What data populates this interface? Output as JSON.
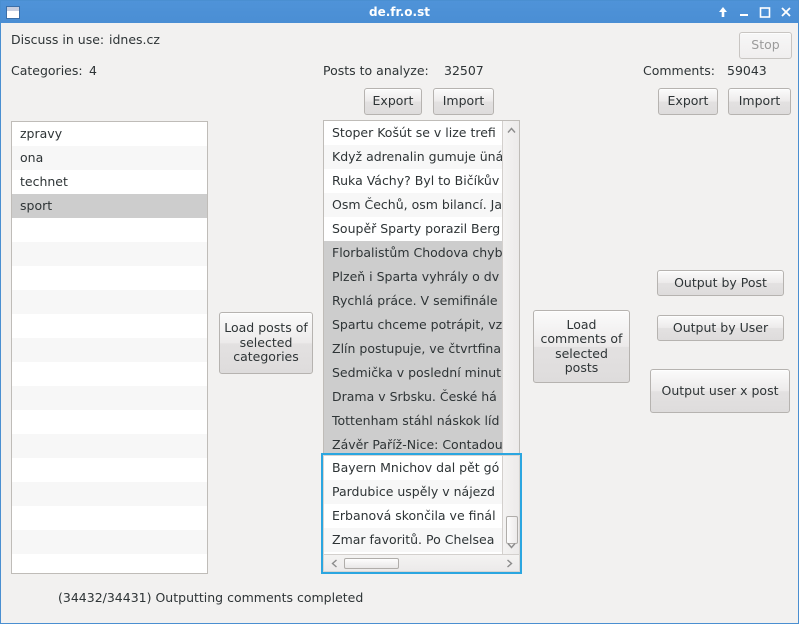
{
  "window": {
    "title": "de.fr.o.st",
    "icon": "window-icon",
    "buttons": [
      {
        "name": "shade-button",
        "icon": "up-arrow-icon",
        "label": "↑"
      },
      {
        "name": "minimize-button",
        "icon": "minimize-icon",
        "label": "_"
      },
      {
        "name": "maximize-button",
        "icon": "maximize-icon",
        "label": "□"
      },
      {
        "name": "close-button",
        "icon": "close-icon",
        "label": "X"
      }
    ]
  },
  "header": {
    "discuss_label": "Discuss in use:",
    "discuss_value": "idnes.cz",
    "stop_label": "Stop",
    "stop_enabled": false,
    "categories_label": "Categories:",
    "categories_value": "4",
    "posts_label": "Posts to analyze:",
    "posts_value": "32507",
    "comments_label": "Comments:",
    "comments_value": "59043",
    "posts_export_label": "Export",
    "posts_import_label": "Import",
    "comments_export_label": "Export",
    "comments_import_label": "Import"
  },
  "categories": {
    "items": [
      {
        "label": "zpravy",
        "selected": false
      },
      {
        "label": "ona",
        "selected": false
      },
      {
        "label": "technet",
        "selected": false
      },
      {
        "label": "sport",
        "selected": true
      },
      {
        "label": "",
        "selected": false
      },
      {
        "label": "",
        "selected": false
      },
      {
        "label": "",
        "selected": false
      },
      {
        "label": "",
        "selected": false
      },
      {
        "label": "",
        "selected": false
      },
      {
        "label": "",
        "selected": false
      },
      {
        "label": "",
        "selected": false
      },
      {
        "label": "",
        "selected": false
      },
      {
        "label": "",
        "selected": false
      },
      {
        "label": "",
        "selected": false
      },
      {
        "label": "",
        "selected": false
      },
      {
        "label": "",
        "selected": false
      },
      {
        "label": "",
        "selected": false
      },
      {
        "label": "",
        "selected": false
      }
    ]
  },
  "load_posts_button": "Load posts of selected categories",
  "load_comments_button": "Load comments of selected posts",
  "posts": {
    "items": [
      {
        "label": "Stoper Košút se v lize trefi",
        "selected": false
      },
      {
        "label": "Když adrenalin gumuje üná",
        "selected": false
      },
      {
        "label": "Ruka Váchy? Byl to Bičíkův",
        "selected": false
      },
      {
        "label": "Osm Čechů, osm bilancí. Ja",
        "selected": false
      },
      {
        "label": "Soupěř Sparty porazil Berg",
        "selected": false
      },
      {
        "label": "Florbalistům Chodova chyb",
        "selected": true
      },
      {
        "label": "Plzeň i Sparta vyhrály o dv",
        "selected": true
      },
      {
        "label": "Rychlá práce. V semifinále",
        "selected": true
      },
      {
        "label": "Spartu chceme potrápit, vz",
        "selected": true
      },
      {
        "label": "Zlín postupuje, ve čtvrtfina",
        "selected": true
      },
      {
        "label": "Sedmička v poslední minut",
        "selected": true
      },
      {
        "label": "Drama v Srbsku. České há",
        "selected": true
      },
      {
        "label": "Tottenham stáhl náskok líd",
        "selected": true
      },
      {
        "label": "Závěr Paříž-Nice: Contadou",
        "selected": true
      }
    ],
    "overlay_items": [
      {
        "label": "Bayern Mnichov dal pět gó",
        "selected": false
      },
      {
        "label": "Pardubice uspěly v nájezd",
        "selected": false
      },
      {
        "label": "Erbanová skončila ve finál",
        "selected": false
      },
      {
        "label": "Zmar favoritů. Po Chelsea ",
        "selected": false
      }
    ],
    "vscroll_up_icon": "chevron-up-icon",
    "vscroll_down_icon": "chevron-down-icon",
    "hscroll_left_icon": "chevron-left-icon",
    "hscroll_right_icon": "chevron-right-icon"
  },
  "outputs": {
    "by_post": "Output by Post",
    "by_user": "Output by User",
    "user_x_post": "Output user x post"
  },
  "status": "(34432/34431) Outputting comments completed",
  "colors": {
    "titlebar": "#4a8fd1",
    "focus_ring": "#2ba6e0",
    "selection": "#cdcdcd",
    "background": "#f2f1f0",
    "text": "#2e3436",
    "disabled_text": "#9b9b9b"
  }
}
